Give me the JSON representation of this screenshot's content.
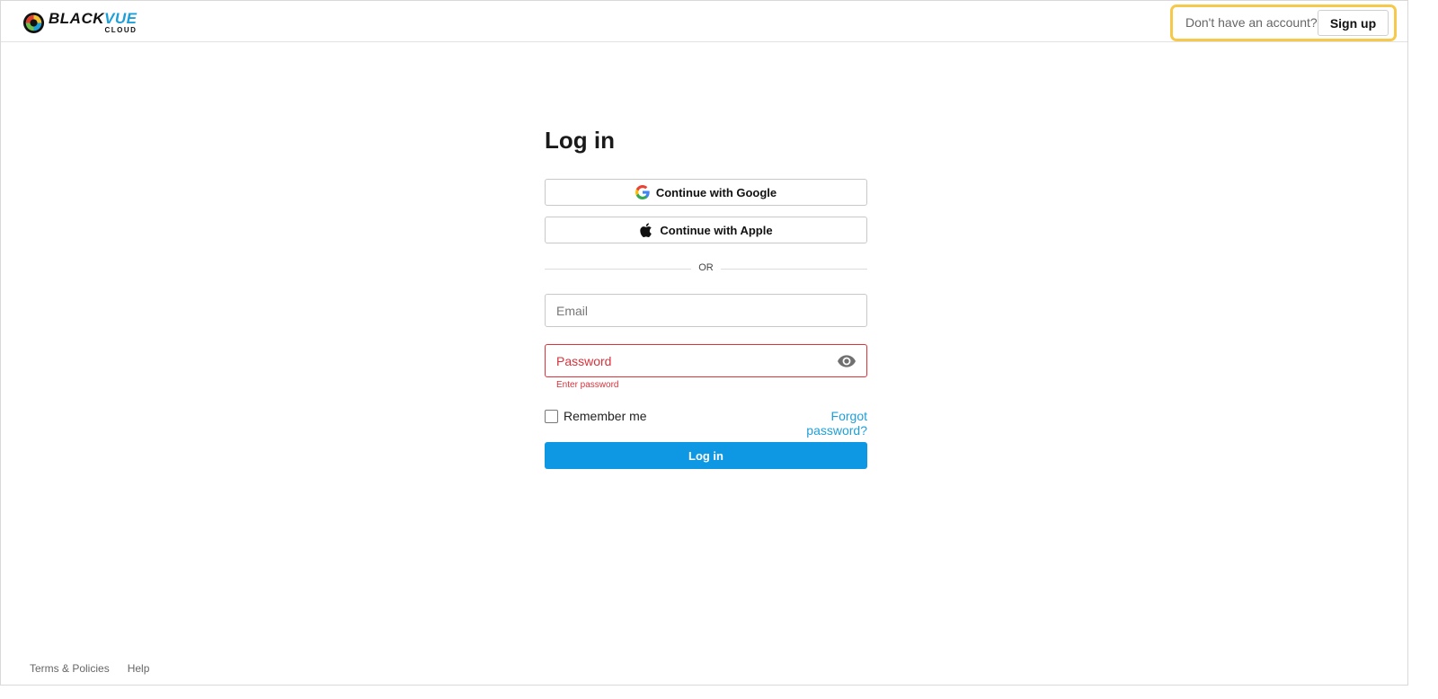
{
  "header": {
    "logo": {
      "word_black": "BLACK",
      "word_blue": "VUE",
      "sub": "CLOUD"
    },
    "signup_prompt": "Don't have an account?",
    "signup_label": "Sign up"
  },
  "login": {
    "title": "Log in",
    "google_label": "Continue with Google",
    "apple_label": "Continue with Apple",
    "divider_text": "OR",
    "email": {
      "value": "",
      "placeholder": "Email"
    },
    "password": {
      "value": "",
      "placeholder": "Password",
      "error": "Enter password"
    },
    "remember_label": "Remember me",
    "remember_checked": false,
    "forgot_label": "Forgot password?",
    "submit_label": "Log in"
  },
  "footer": {
    "links": [
      "Terms & Policies",
      "Help"
    ]
  },
  "colors": {
    "accent": "#0e97e2",
    "link": "#1e9fd8",
    "error": "#d8323b",
    "highlight": "#f7c94a"
  },
  "icons": {
    "logo": "blackvue-logo-icon",
    "google": "google-icon",
    "apple": "apple-icon",
    "show_password": "eye-icon"
  }
}
